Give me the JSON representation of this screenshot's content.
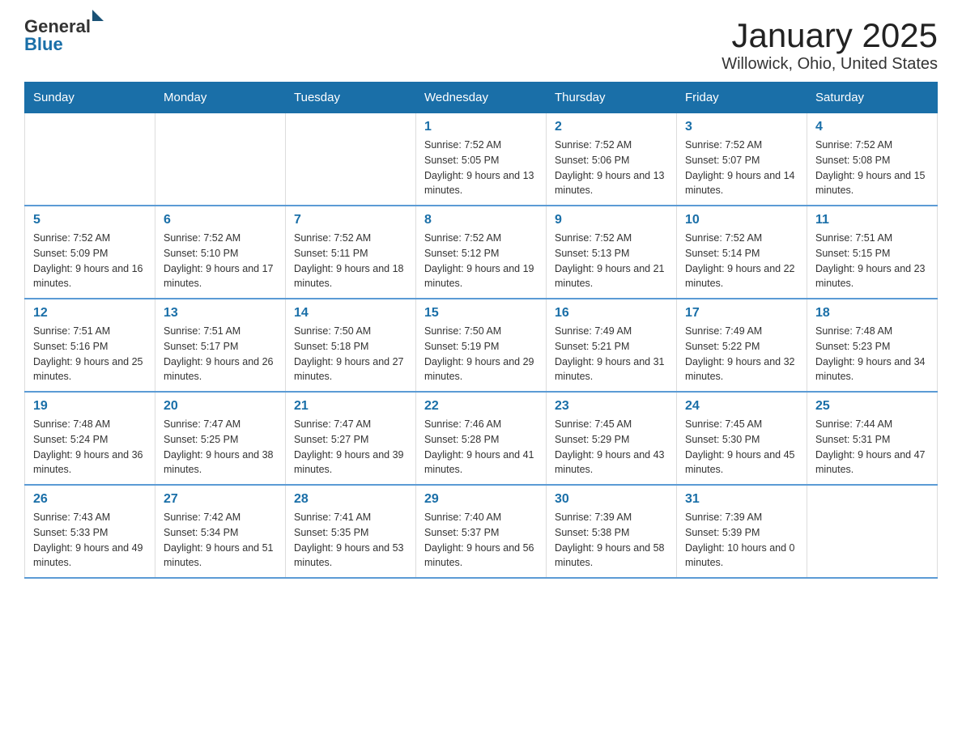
{
  "header": {
    "logo_general": "General",
    "logo_blue": "Blue",
    "title": "January 2025",
    "subtitle": "Willowick, Ohio, United States"
  },
  "calendar": {
    "days_of_week": [
      "Sunday",
      "Monday",
      "Tuesday",
      "Wednesday",
      "Thursday",
      "Friday",
      "Saturday"
    ],
    "weeks": [
      [
        {
          "date": "",
          "info": ""
        },
        {
          "date": "",
          "info": ""
        },
        {
          "date": "",
          "info": ""
        },
        {
          "date": "1",
          "info": "Sunrise: 7:52 AM\nSunset: 5:05 PM\nDaylight: 9 hours\nand 13 minutes."
        },
        {
          "date": "2",
          "info": "Sunrise: 7:52 AM\nSunset: 5:06 PM\nDaylight: 9 hours\nand 13 minutes."
        },
        {
          "date": "3",
          "info": "Sunrise: 7:52 AM\nSunset: 5:07 PM\nDaylight: 9 hours\nand 14 minutes."
        },
        {
          "date": "4",
          "info": "Sunrise: 7:52 AM\nSunset: 5:08 PM\nDaylight: 9 hours\nand 15 minutes."
        }
      ],
      [
        {
          "date": "5",
          "info": "Sunrise: 7:52 AM\nSunset: 5:09 PM\nDaylight: 9 hours\nand 16 minutes."
        },
        {
          "date": "6",
          "info": "Sunrise: 7:52 AM\nSunset: 5:10 PM\nDaylight: 9 hours\nand 17 minutes."
        },
        {
          "date": "7",
          "info": "Sunrise: 7:52 AM\nSunset: 5:11 PM\nDaylight: 9 hours\nand 18 minutes."
        },
        {
          "date": "8",
          "info": "Sunrise: 7:52 AM\nSunset: 5:12 PM\nDaylight: 9 hours\nand 19 minutes."
        },
        {
          "date": "9",
          "info": "Sunrise: 7:52 AM\nSunset: 5:13 PM\nDaylight: 9 hours\nand 21 minutes."
        },
        {
          "date": "10",
          "info": "Sunrise: 7:52 AM\nSunset: 5:14 PM\nDaylight: 9 hours\nand 22 minutes."
        },
        {
          "date": "11",
          "info": "Sunrise: 7:51 AM\nSunset: 5:15 PM\nDaylight: 9 hours\nand 23 minutes."
        }
      ],
      [
        {
          "date": "12",
          "info": "Sunrise: 7:51 AM\nSunset: 5:16 PM\nDaylight: 9 hours\nand 25 minutes."
        },
        {
          "date": "13",
          "info": "Sunrise: 7:51 AM\nSunset: 5:17 PM\nDaylight: 9 hours\nand 26 minutes."
        },
        {
          "date": "14",
          "info": "Sunrise: 7:50 AM\nSunset: 5:18 PM\nDaylight: 9 hours\nand 27 minutes."
        },
        {
          "date": "15",
          "info": "Sunrise: 7:50 AM\nSunset: 5:19 PM\nDaylight: 9 hours\nand 29 minutes."
        },
        {
          "date": "16",
          "info": "Sunrise: 7:49 AM\nSunset: 5:21 PM\nDaylight: 9 hours\nand 31 minutes."
        },
        {
          "date": "17",
          "info": "Sunrise: 7:49 AM\nSunset: 5:22 PM\nDaylight: 9 hours\nand 32 minutes."
        },
        {
          "date": "18",
          "info": "Sunrise: 7:48 AM\nSunset: 5:23 PM\nDaylight: 9 hours\nand 34 minutes."
        }
      ],
      [
        {
          "date": "19",
          "info": "Sunrise: 7:48 AM\nSunset: 5:24 PM\nDaylight: 9 hours\nand 36 minutes."
        },
        {
          "date": "20",
          "info": "Sunrise: 7:47 AM\nSunset: 5:25 PM\nDaylight: 9 hours\nand 38 minutes."
        },
        {
          "date": "21",
          "info": "Sunrise: 7:47 AM\nSunset: 5:27 PM\nDaylight: 9 hours\nand 39 minutes."
        },
        {
          "date": "22",
          "info": "Sunrise: 7:46 AM\nSunset: 5:28 PM\nDaylight: 9 hours\nand 41 minutes."
        },
        {
          "date": "23",
          "info": "Sunrise: 7:45 AM\nSunset: 5:29 PM\nDaylight: 9 hours\nand 43 minutes."
        },
        {
          "date": "24",
          "info": "Sunrise: 7:45 AM\nSunset: 5:30 PM\nDaylight: 9 hours\nand 45 minutes."
        },
        {
          "date": "25",
          "info": "Sunrise: 7:44 AM\nSunset: 5:31 PM\nDaylight: 9 hours\nand 47 minutes."
        }
      ],
      [
        {
          "date": "26",
          "info": "Sunrise: 7:43 AM\nSunset: 5:33 PM\nDaylight: 9 hours\nand 49 minutes."
        },
        {
          "date": "27",
          "info": "Sunrise: 7:42 AM\nSunset: 5:34 PM\nDaylight: 9 hours\nand 51 minutes."
        },
        {
          "date": "28",
          "info": "Sunrise: 7:41 AM\nSunset: 5:35 PM\nDaylight: 9 hours\nand 53 minutes."
        },
        {
          "date": "29",
          "info": "Sunrise: 7:40 AM\nSunset: 5:37 PM\nDaylight: 9 hours\nand 56 minutes."
        },
        {
          "date": "30",
          "info": "Sunrise: 7:39 AM\nSunset: 5:38 PM\nDaylight: 9 hours\nand 58 minutes."
        },
        {
          "date": "31",
          "info": "Sunrise: 7:39 AM\nSunset: 5:39 PM\nDaylight: 10 hours\nand 0 minutes."
        },
        {
          "date": "",
          "info": ""
        }
      ]
    ]
  }
}
